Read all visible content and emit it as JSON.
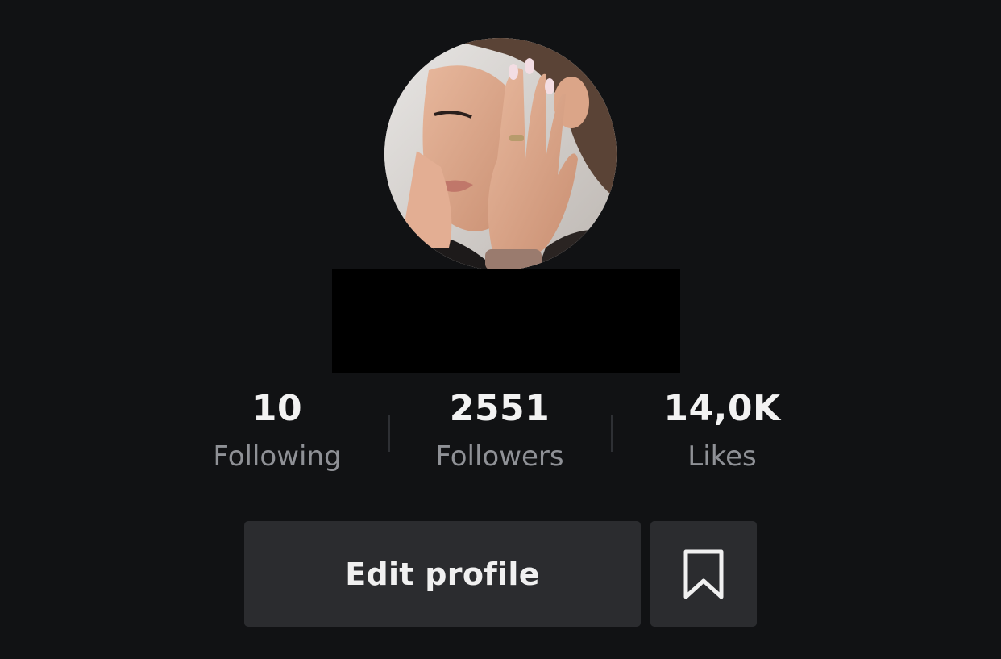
{
  "profile": {
    "avatar_icon": "profile-photo",
    "username": ""
  },
  "stats": [
    {
      "value": "10",
      "label": "Following"
    },
    {
      "value": "2551",
      "label": "Followers"
    },
    {
      "value": "14,0K",
      "label": "Likes"
    }
  ],
  "actions": {
    "edit_profile_label": "Edit profile",
    "bookmark_icon": "bookmark-icon"
  },
  "colors": {
    "background": "#111214",
    "button_bg": "#2b2c2f",
    "label_gray": "#8f9196",
    "value_white": "#f2f2f2"
  }
}
